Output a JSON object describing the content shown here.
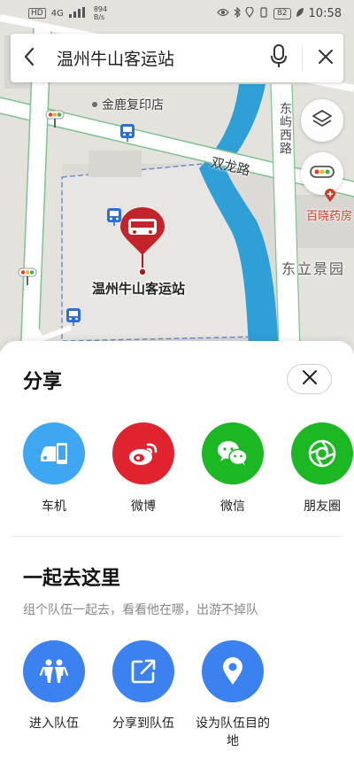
{
  "status_bar": {
    "network": "HD",
    "signal": "4G",
    "speed_value": "894",
    "speed_unit": "B/s",
    "battery": "82",
    "time": "10:58"
  },
  "search": {
    "query": "温州牛山客运站"
  },
  "map": {
    "labels": {
      "poi_print": "金鹿复印店",
      "road_shuanglong": "双龙路",
      "road_dongxu": "东屿西路",
      "pharmacy": "百晓药房",
      "community": "东立景园",
      "station": "温州牛山客运站"
    }
  },
  "share_sheet": {
    "title": "分享",
    "share_targets": [
      {
        "label": "车机",
        "icon": "car-phone-icon",
        "color": "#3fa7f2"
      },
      {
        "label": "微博",
        "icon": "weibo-icon",
        "color": "#e0242f"
      },
      {
        "label": "微信",
        "icon": "wechat-icon",
        "color": "#1bb823"
      },
      {
        "label": "朋友圈",
        "icon": "moments-icon",
        "color": "#1bb823"
      }
    ],
    "team_title": "一起去这里",
    "team_subtitle": "组个队伍一起去，看看他在哪，出游不掉队",
    "team_actions": [
      {
        "label": "进入队伍",
        "icon": "group-icon"
      },
      {
        "label": "分享到队伍",
        "icon": "share-out-icon"
      },
      {
        "label": "设为队伍目的地",
        "icon": "location-pin-icon"
      }
    ],
    "accent_color": "#3b82f0"
  }
}
